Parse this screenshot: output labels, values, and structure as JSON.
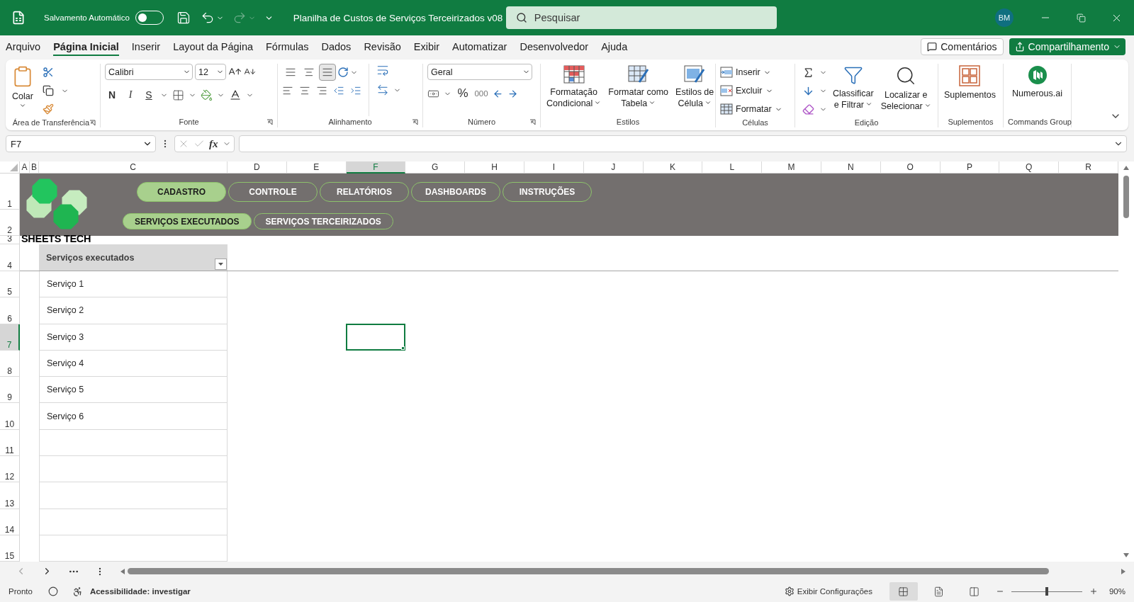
{
  "title_bar": {
    "autosave_label": "Salvamento Automático",
    "autosave_on": false,
    "document_title": "Planilha de Custos de Serviços Terceirizados v08",
    "search_placeholder": "Pesquisar",
    "user_initials": "BM"
  },
  "menu_tabs": [
    {
      "label": "Arquivo",
      "selected": false
    },
    {
      "label": "Página Inicial",
      "selected": true
    },
    {
      "label": "Inserir",
      "selected": false
    },
    {
      "label": "Layout da Página",
      "selected": false
    },
    {
      "label": "Fórmulas",
      "selected": false
    },
    {
      "label": "Dados",
      "selected": false
    },
    {
      "label": "Revisão",
      "selected": false
    },
    {
      "label": "Exibir",
      "selected": false
    },
    {
      "label": "Automatizar",
      "selected": false
    },
    {
      "label": "Desenvolvedor",
      "selected": false
    },
    {
      "label": "Ajuda",
      "selected": false
    }
  ],
  "comments_label": "Comentários",
  "share_label": "Compartilhamento",
  "ribbon": {
    "clipboard": {
      "label": "Área de Transferência",
      "paste_label": "Colar"
    },
    "font": {
      "label": "Fonte",
      "font_name": "Calibri",
      "font_size": "12",
      "bold_label": "N",
      "italic_label": "I",
      "underline_label": "S"
    },
    "alignment": {
      "label": "Alinhamento",
      "vertical_align": [
        {
          "kind": "top",
          "selected": false
        },
        {
          "kind": "middle",
          "selected": false
        },
        {
          "kind": "bottom",
          "selected": true
        }
      ]
    },
    "number": {
      "label": "Número",
      "format": "Geral",
      "percent_label": "%",
      "thousands_label": "000"
    },
    "styles": {
      "label": "Estilos",
      "buttons": [
        {
          "kind": "conditional",
          "lines": [
            "Formatação",
            "Condicional"
          ],
          "dropdown": true
        },
        {
          "kind": "table",
          "lines": [
            "Formatar como",
            "Tabela"
          ],
          "dropdown": true
        },
        {
          "kind": "cell_styles",
          "lines": [
            "Estilos de",
            "Célula"
          ],
          "dropdown": true
        }
      ]
    },
    "cells": {
      "label": "Células",
      "buttons": [
        {
          "kind": "insert",
          "label": "Inserir"
        },
        {
          "kind": "delete",
          "label": "Excluir"
        },
        {
          "kind": "format",
          "label": "Formatar"
        }
      ]
    },
    "editing": {
      "label": "Edição",
      "buttons": [
        {
          "kind": "sort",
          "lines": [
            "Classificar",
            "e Filtrar"
          ],
          "dropdown": true
        },
        {
          "kind": "find",
          "lines": [
            "Localizar e",
            "Selecionar"
          ],
          "dropdown": true
        }
      ]
    },
    "addins": {
      "label": "Suplementos",
      "buttons": [
        {
          "kind": "addins",
          "lines": [
            "Suplementos"
          ],
          "dropdown": false
        }
      ]
    },
    "commands": {
      "label": "Commands Group",
      "buttons": [
        {
          "kind": "numerous",
          "lines": [
            "Numerous.ai"
          ],
          "dropdown": false
        }
      ]
    }
  },
  "formula_bar": {
    "name_box": "F7",
    "function_label": "fx"
  },
  "columns": [
    {
      "label": "A",
      "selected": false
    },
    {
      "label": "B",
      "selected": false
    },
    {
      "label": "C",
      "selected": false
    },
    {
      "label": "D",
      "selected": false
    },
    {
      "label": "E",
      "selected": false
    },
    {
      "label": "F",
      "selected": true
    },
    {
      "label": "G",
      "selected": false
    },
    {
      "label": "H",
      "selected": false
    },
    {
      "label": "I",
      "selected": false
    },
    {
      "label": "J",
      "selected": false
    },
    {
      "label": "K",
      "selected": false
    },
    {
      "label": "L",
      "selected": false
    },
    {
      "label": "M",
      "selected": false
    },
    {
      "label": "N",
      "selected": false
    },
    {
      "label": "O",
      "selected": false
    },
    {
      "label": "P",
      "selected": false
    },
    {
      "label": "Q",
      "selected": false
    },
    {
      "label": "R",
      "selected": false
    }
  ],
  "rows": [
    {
      "label": "1",
      "selected": false
    },
    {
      "label": "2",
      "selected": false
    },
    {
      "label": "3",
      "selected": false
    },
    {
      "label": "4",
      "selected": false
    },
    {
      "label": "5",
      "selected": false
    },
    {
      "label": "6",
      "selected": false
    },
    {
      "label": "7",
      "selected": true
    },
    {
      "label": "8",
      "selected": false
    },
    {
      "label": "9",
      "selected": false
    },
    {
      "label": "10",
      "selected": false
    },
    {
      "label": "11",
      "selected": false
    },
    {
      "label": "12",
      "selected": false
    },
    {
      "label": "13",
      "selected": false
    },
    {
      "label": "14",
      "selected": false
    },
    {
      "label": "15",
      "selected": false
    }
  ],
  "banner": {
    "logo_text": "SHEETS TECH",
    "primary_nav": [
      {
        "label": "CADASTRO",
        "selected": true
      },
      {
        "label": "CONTROLE",
        "selected": false
      },
      {
        "label": "RELATÓRIOS",
        "selected": false
      },
      {
        "label": "DASHBOARDS",
        "selected": false
      },
      {
        "label": "INSTRUÇÕES",
        "selected": false
      }
    ],
    "secondary_nav": [
      {
        "label": "SERVIÇOS EXECUTADOS",
        "selected": true
      },
      {
        "label": "SERVIÇOS TERCEIRIZADOS",
        "selected": false
      }
    ]
  },
  "table": {
    "header": "Serviços executados",
    "rows": [
      "Serviço 1",
      "Serviço 2",
      "Serviço 3",
      "Serviço 4",
      "Serviço 5",
      "Serviço 6"
    ]
  },
  "status_bar": {
    "ready": "Pronto",
    "accessibility": "Acessibilidade: investigar",
    "display_settings": "Exibir Configurações",
    "views": [
      {
        "kind": "normal",
        "selected": true
      },
      {
        "kind": "page_layout",
        "selected": false
      },
      {
        "kind": "page_break",
        "selected": false
      }
    ],
    "zoom": {
      "level": 0.5,
      "label": "90%"
    }
  }
}
